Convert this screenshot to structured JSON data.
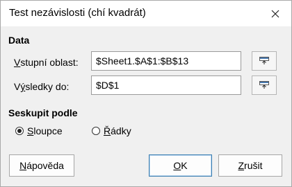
{
  "window": {
    "title": "Test nezávislosti (chí kvadrát)"
  },
  "data_section": {
    "title": "Data",
    "input_range": {
      "label_accel": "V",
      "label_rest": "stupní oblast:",
      "value": "$Sheet1.$A$1:$B$13"
    },
    "results_to": {
      "label_pre": "V",
      "label_accel": "ý",
      "label_rest": "sledky do:",
      "value": "$D$1"
    }
  },
  "group_section": {
    "title": "Seskupit podle",
    "options": [
      {
        "accel": "S",
        "rest": "loupce",
        "checked": true
      },
      {
        "accel": "Ř",
        "rest": "ádky",
        "checked": false
      }
    ]
  },
  "buttons": {
    "help": {
      "accel": "N",
      "rest": "ápověda"
    },
    "ok": {
      "accel": "O",
      "rest": "K"
    },
    "cancel": {
      "accel": "Z",
      "rest": "rušit"
    }
  }
}
